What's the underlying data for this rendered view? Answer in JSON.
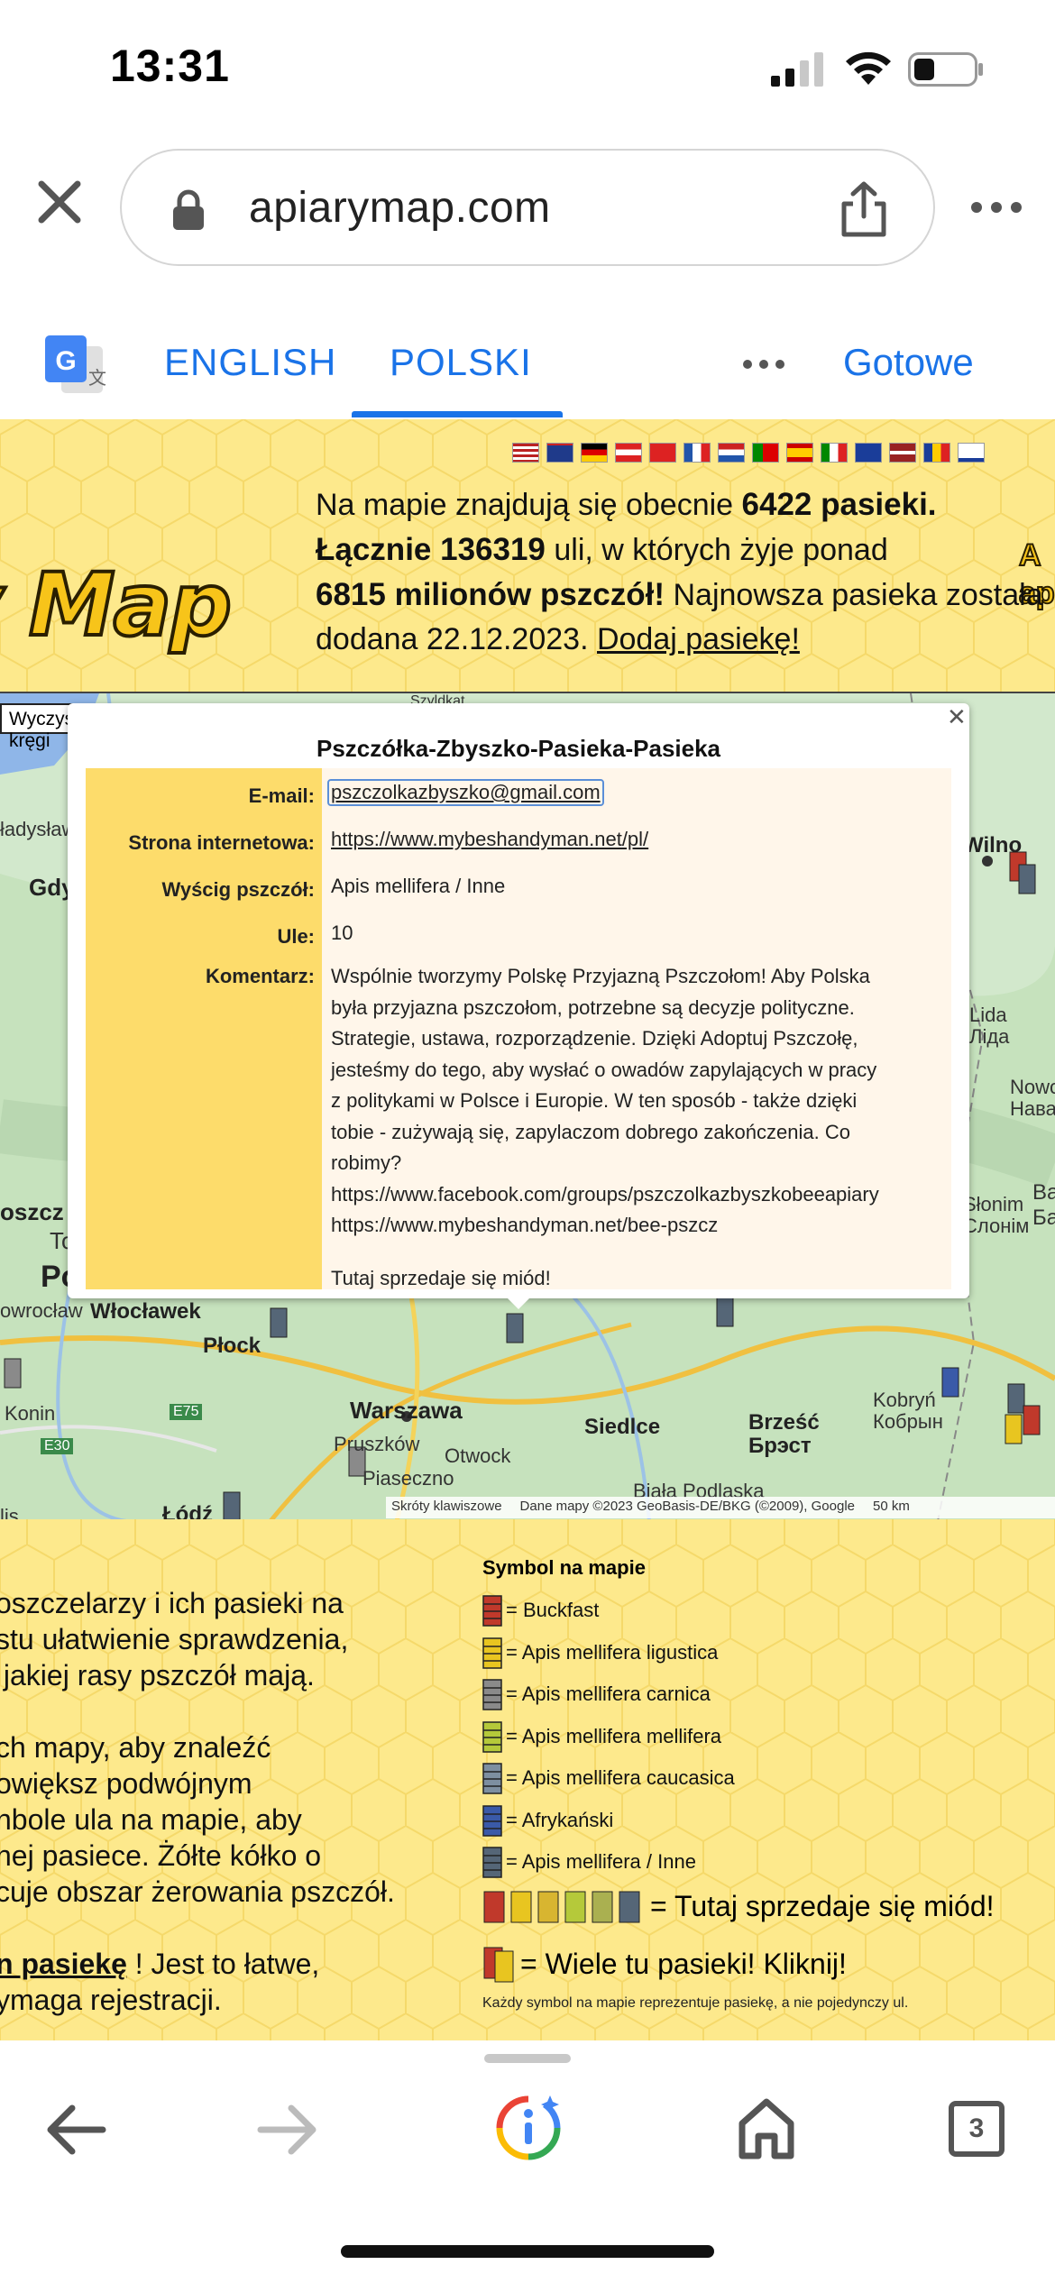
{
  "status_bar": {
    "time": "13:31"
  },
  "browser": {
    "url": "apiarymap.com"
  },
  "translate_bar": {
    "tab_english": "ENGLISH",
    "tab_polski": "POLSKI",
    "done": "Gotowe"
  },
  "header": {
    "stats_part1": "Na mapie znajdują się obecnie ",
    "stats_apiaries": "6422 pasieki.",
    "stats_hives": "Łącznie 136319",
    "stats_part2": " uli, w których żyje ponad ",
    "stats_bees": "6815 milionów pszczół!",
    "stats_part3": " Najnowsza pasieka została dodana 22.12.2023. ",
    "add_link": "Dodaj pasiekę!",
    "logo_text": "y Map"
  },
  "map": {
    "clear_button": "Wyczyść kręgi",
    "labels": {
      "wilno": "Wilno",
      "lida": "Lida\nЛіда",
      "nowo": "Nowo\nНава",
      "slonim": "Słonim\nСлонім",
      "ba": "Ba\nБа",
      "wloclawek": "Włocławek",
      "plock": "Płock",
      "owroclaw": "owrocław",
      "konin": "Konin",
      "warszawa": "Warszawa",
      "pruszkow": "Pruszków",
      "otwock": "Otwock",
      "piaseczno": "Piaseczno",
      "siedlce": "Siedlce",
      "brzesc": "Brześć\nБрэст",
      "kobryn": "Kobryń\nКобрын",
      "biala": "Biała Podlaska",
      "lodz": "Łódź",
      "gdy": "Gdy",
      "ladyslaw": "ładysław",
      "oszcz": "oszcz",
      "to": "To",
      "po": "Po",
      "lis": "lis",
      "e75": "E75",
      "e30": "E30",
      "szyldkat": "Szyldkat..."
    },
    "footer": {
      "shortcuts": "Skróty klawiszowe",
      "attribution": "Dane mapy ©2023 GeoBasis-DE/BKG (©2009), Google",
      "scale": "50 km"
    }
  },
  "popup": {
    "title": "Pszczółka-Zbyszko-Pasieka-Pasieka",
    "email_label": "E-mail:",
    "email_value": "pszczolkazbyszko@gmail.com",
    "website_label": "Strona internetowa:",
    "website_value": "https://www.mybeshandyman.net/pl/",
    "race_label": "Wyścig pszczół:",
    "race_value": "Apis mellifera / Inne",
    "hives_label": "Ule:",
    "hives_value": "10",
    "comment_label": "Komentarz:",
    "comment_value": "Wspólnie tworzymy Polskę Przyjazną Pszczołom! Aby Polska\nbyła przyjazna pszczołom, potrzebne są decyzje polityczne.\nStrategie, ustawa, rozporządzenie. Dzięki Adoptuj Pszczołę,\njesteśmy do tego, aby wysłać o owadów zapylających w pracy\nz politykami w Polsce i Europie. W ten sposób - także dzięki\ntobie - zużywają się, zapylaczom dobrego zakończenia. Co\nrobimy?\nhttps://www.facebook.com/groups/pszczolkazbyszkobeeapiary\nhttps://www.mybeshandyman.net/bee-pszcz",
    "honey_note": "Tutaj sprzedaje się miód!"
  },
  "info_text": {
    "lines": "oszczelarzy i ich pasieki na\nstu ułatwienie sprawdzenia,\n jakiej rasy pszczół mają.\n\nch mapy, aby znaleźć\nowiększ podwójnym\nnbole ula na mapie, aby\nnej pasiece. Żółte kółko o\ncuje obszar żerowania pszczół.\n\n",
    "link_part": "n pasiekę",
    "tail": " ! Jest to łatwe,\nymaga rejestracji."
  },
  "legend": {
    "title": "Symbol na mapie",
    "items": [
      {
        "label": "= Buckfast",
        "color": "#c0392b"
      },
      {
        "label": "= Apis mellifera ligustica",
        "color": "#e8c520"
      },
      {
        "label": "= Apis mellifera carnica",
        "color": "#8a8a8a"
      },
      {
        "label": "= Apis mellifera mellifera",
        "color": "#b5c93a"
      },
      {
        "label": "= Apis mellifera caucasica",
        "color": "#7d8fa0"
      },
      {
        "label": "= Afrykański",
        "color": "#3a5aa8"
      },
      {
        "label": "= Apis mellifera / Inne",
        "color": "#556677"
      }
    ],
    "honey": "= Tutaj sprzedaje się miód!",
    "many": "= Wiele tu pasieki! Kliknij!",
    "note": "Każdy symbol na mapie reprezentuje pasiekę, a nie pojedynczy ul."
  },
  "bottom_nav": {
    "tabs_count": "3"
  },
  "colors": {
    "accent": "#1a73e8",
    "page_bg": "#fde98c",
    "label_col": "#fddc6b"
  }
}
